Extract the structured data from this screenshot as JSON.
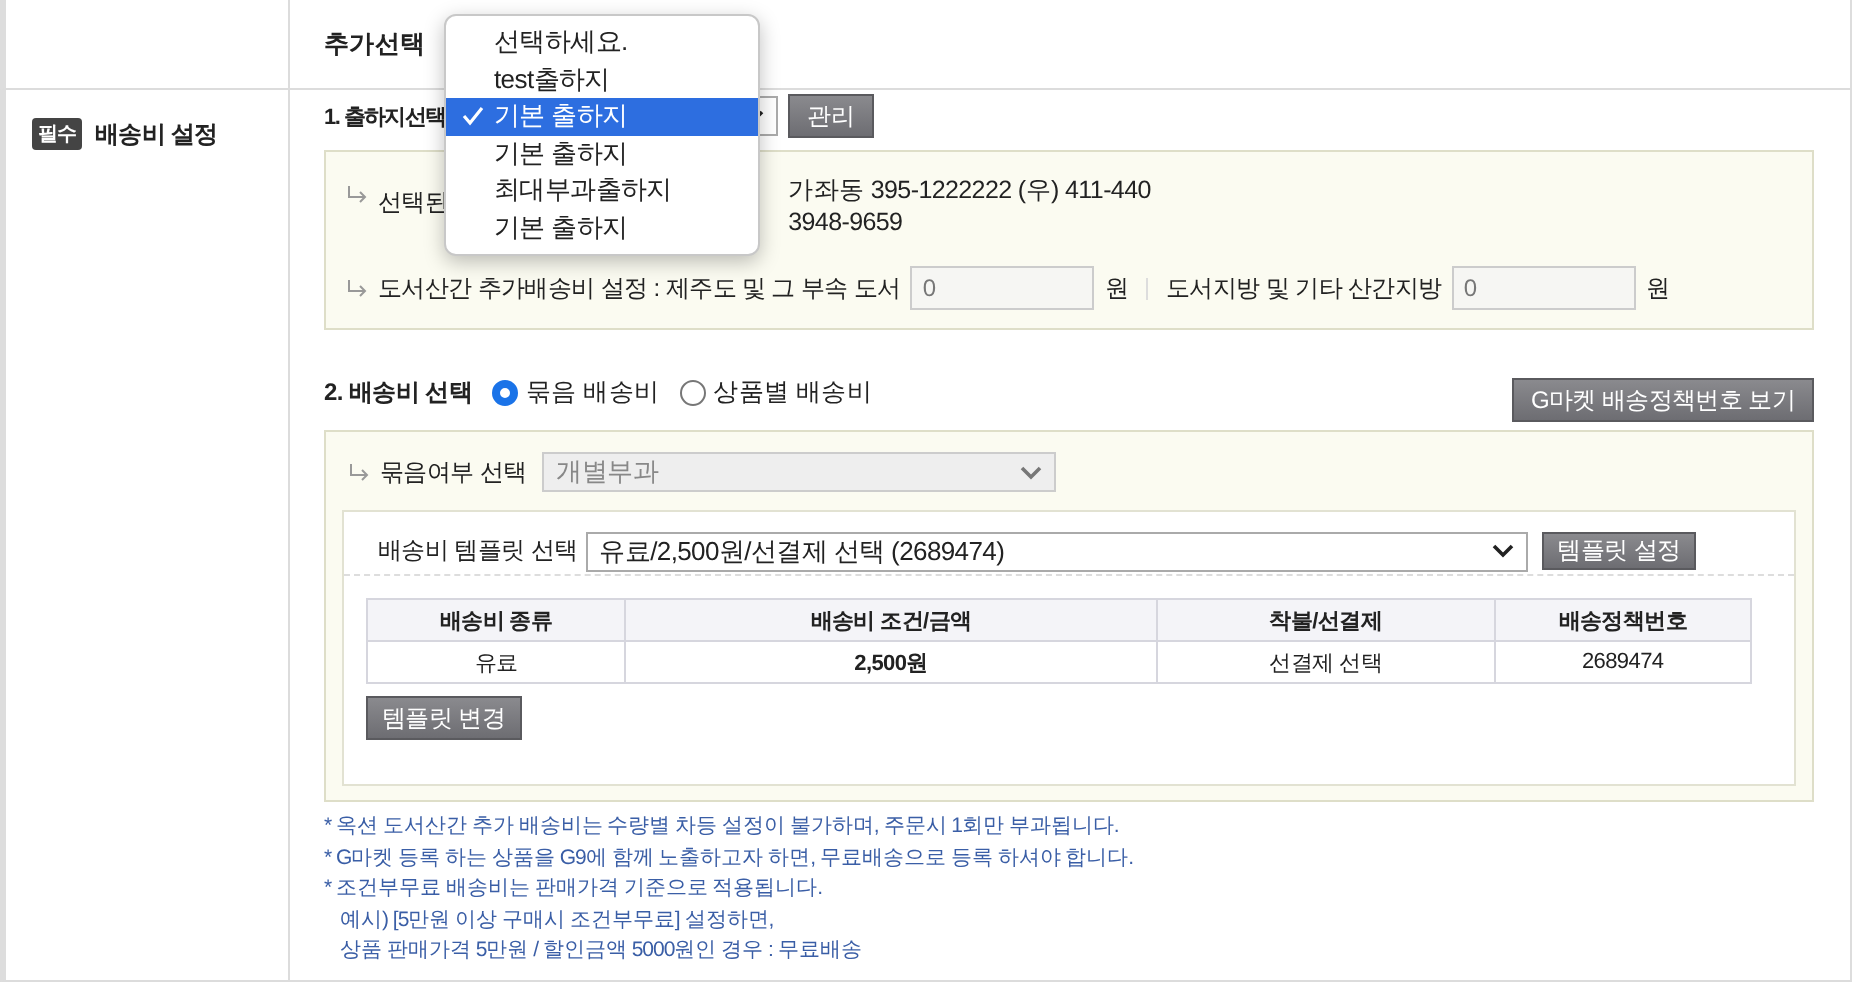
{
  "extra_selection": {
    "label": "추가선택"
  },
  "section": {
    "badge": "필수",
    "title": "배송비 설정"
  },
  "origin": {
    "label": "1. 출하지선택",
    "manage_button": "관리",
    "menu": [
      {
        "label": "선택하세요.",
        "selected": false
      },
      {
        "label": "test출하지",
        "selected": false
      },
      {
        "label": "기본 출하지",
        "selected": true
      },
      {
        "label": "기본 출하지",
        "selected": false
      },
      {
        "label": "최대부과출하지",
        "selected": false
      },
      {
        "label": "기본 출하지",
        "selected": false
      }
    ],
    "address_label": "선택된",
    "address_line_1": "가좌동 395-1222222 (우) 411-440",
    "address_line_2": "3948-9659",
    "surcharge_label": "도서산간 추가배송비 설정 : 제주도 및 그 부속 도서",
    "jeju_value": "0",
    "unit_1": "원",
    "mountain_label": "도서지방 및 기타 산간지방",
    "mountain_value": "0",
    "unit_2": "원"
  },
  "fee": {
    "label": "2. 배송비 선택",
    "options": [
      {
        "label": "묶음 배송비",
        "selected": true
      },
      {
        "label": "상품별 배송비",
        "selected": false
      }
    ],
    "policy_button": "G마켓 배송정책번호 보기",
    "bundle_label": "묶음여부 선택",
    "bundle_value": "개별부과",
    "bundle_disabled": true,
    "template_label": "배송비 템플릿 선택",
    "template_value": "유료/2,500원/선결제 선택 (2689474)",
    "template_button": "템플릿 설정",
    "table": {
      "columns": [
        "배송비 종류",
        "배송비 조건/금액",
        "착불/선결제",
        "배송정책번호"
      ],
      "rows": [
        [
          "유료",
          "2,500원",
          "선결제 선택",
          "2689474"
        ]
      ]
    },
    "change_button": "템플릿 변경"
  },
  "notes": [
    "* 옥션 도서산간 추가 배송비는 수량별 차등 설정이 불가하며, 주문시 1회만 부과됩니다.",
    "* G마켓 등록 하는 상품을 G9에 함께 노출하고자 하면, 무료배송으로 등록 하셔야 합니다.",
    "* 조건부무료 배송비는 판매가격 기준으로 적용됩니다.",
    "예시) [5만원 이상 구매시 조건부무료] 설정하면,",
    "상품 판매가격 5만원 / 할인금액 5000원인 경우 : 무료배송"
  ]
}
